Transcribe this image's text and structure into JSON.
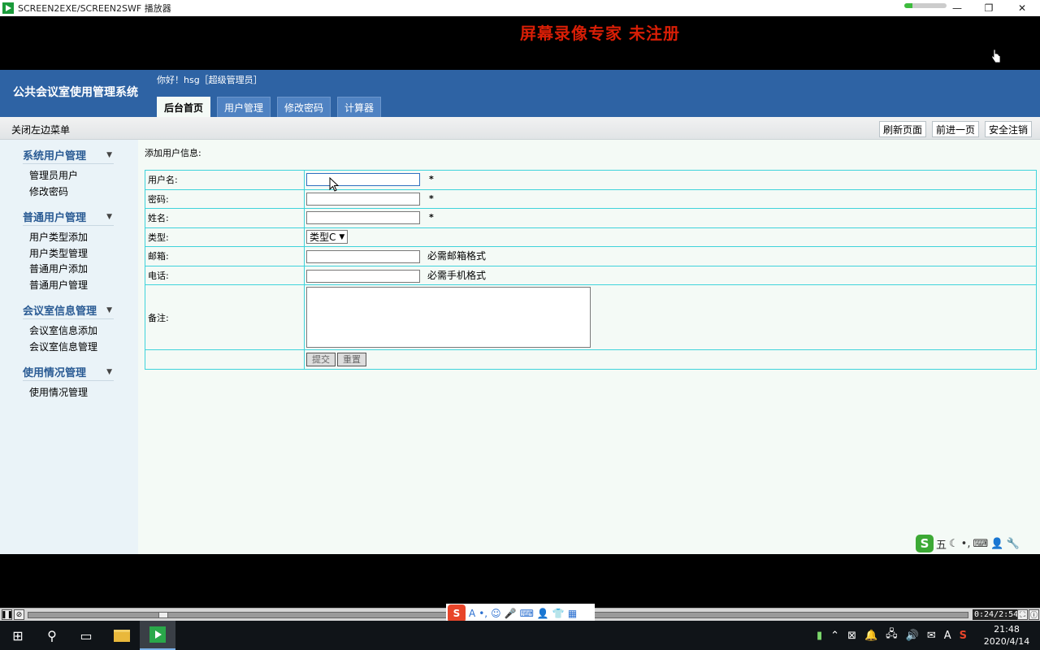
{
  "window": {
    "title": "SCREEN2EXE/SCREEN2SWF 播放器",
    "progress_fraction": 0.2,
    "controls": {
      "minimize": "—",
      "restore": "❐",
      "close": "✕"
    }
  },
  "watermark": "屏幕录像专家 未注册",
  "app": {
    "system_title": "公共会议室使用管理系统",
    "greeting": "你好！hsg［超级管理员］",
    "tabs": [
      {
        "label": "后台首页",
        "active": true
      },
      {
        "label": "用户管理",
        "active": false
      },
      {
        "label": "修改密码",
        "active": false
      },
      {
        "label": "计算器",
        "active": false
      }
    ],
    "toolbar": {
      "close_left_menu": "关闭左边菜单",
      "refresh": "刷新页面",
      "forward": "前进一页",
      "logout": "安全注销"
    },
    "sidebar": [
      {
        "title": "系统用户管理",
        "items": [
          "管理员用户",
          "修改密码"
        ]
      },
      {
        "title": "普通用户管理",
        "items": [
          "用户类型添加",
          "用户类型管理",
          "普通用户添加",
          "普通用户管理"
        ]
      },
      {
        "title": "会议室信息管理",
        "items": [
          "会议室信息添加",
          "会议室信息管理"
        ]
      },
      {
        "title": "使用情况管理",
        "items": [
          "使用情况管理"
        ]
      }
    ],
    "form": {
      "title": "添加用户信息:",
      "username_label": "用户名:",
      "password_label": "密码:",
      "name_label": "姓名:",
      "type_label": "类型:",
      "type_value": "类型C",
      "email_label": "邮箱:",
      "email_hint": "必需邮箱格式",
      "phone_label": "电话:",
      "phone_hint": "必需手机格式",
      "remark_label": "备注:",
      "required_mark": "*",
      "submit": "提交",
      "reset": "重置"
    }
  },
  "ime": {
    "logo": "S",
    "mode": "五"
  },
  "player": {
    "pause": "❚❚",
    "stop": "⊘",
    "timecode": "0:24/2:54",
    "progress_fraction": 0.14
  },
  "taskbar": {
    "time": "21:48",
    "date": "2020/4/14",
    "input_indicator": "A"
  }
}
